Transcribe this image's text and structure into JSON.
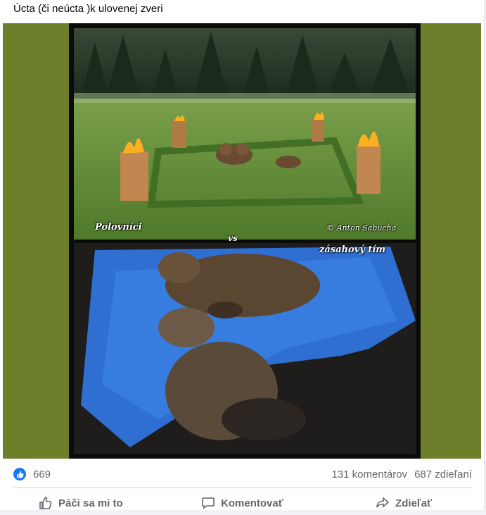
{
  "post": {
    "text": "Úcta (či neúcta )k ulovenej zveri"
  },
  "image": {
    "label_left": "Polovníci",
    "label_vs": "vs",
    "credit": "© Anton Sabucha",
    "label_team": "zásahový tím"
  },
  "stats": {
    "reactions": "669",
    "comments": "131 komentárov",
    "shares": "687 zdieľaní"
  },
  "actions": {
    "like": "Páči sa mi to",
    "comment": "Komentovať",
    "share": "Zdieľať"
  },
  "colors": {
    "background": "#6e7f2c",
    "accent": "#1877f2"
  },
  "icons": [
    "like-icon",
    "comment-icon",
    "share-icon",
    "thumbs-up-badge-icon"
  ]
}
